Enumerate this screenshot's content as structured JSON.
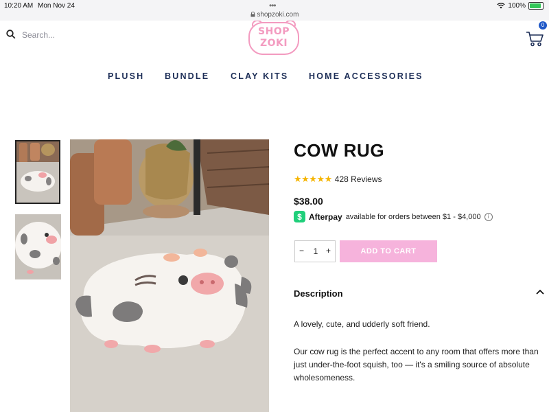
{
  "status_bar": {
    "time": "10:20 AM",
    "date": "Mon Nov 24",
    "dots": "•••",
    "url": "shopzoki.com",
    "battery": "100%",
    "icons": [
      "wifi-icon",
      "battery-icon",
      "lock-icon"
    ]
  },
  "header": {
    "search_placeholder": "Search...",
    "logo_line1": "SHOP",
    "logo_line2": "ZOKI",
    "cart_count": "0",
    "icons": [
      "search-icon",
      "cart-icon"
    ]
  },
  "nav": {
    "items": [
      {
        "label": "PLUSH"
      },
      {
        "label": "BUNDLE"
      },
      {
        "label": "CLAY KITS"
      },
      {
        "label": "HOME ACCESSORIES"
      }
    ]
  },
  "product": {
    "title": "COW RUG",
    "stars": "★★★★★",
    "rating": 5,
    "reviews": "428 Reviews",
    "price": "$38.00",
    "afterpay_logo": "$",
    "afterpay_brand": "Afterpay",
    "afterpay_text": "available for orders between $1 - $4,000",
    "afterpay_info": "i",
    "qty_minus": "−",
    "quantity": "1",
    "qty_plus": "+",
    "add_to_cart": "ADD TO CART",
    "description_heading": "Description",
    "description_p1": "A lovely, cute, and udderly soft friend.",
    "description_p2": "Our cow rug is the perfect accent to any room that offers more than just under-the-foot squish, too — it's a smiling source of absolute wholesomeness."
  },
  "colors": {
    "accent_pink": "#f6b3dc",
    "logo_pink": "#f39bc0",
    "nav_navy": "#1d2e57",
    "star_gold": "#f5b400",
    "afterpay_green": "#1fcf7a",
    "badge_blue": "#1f58c7"
  }
}
